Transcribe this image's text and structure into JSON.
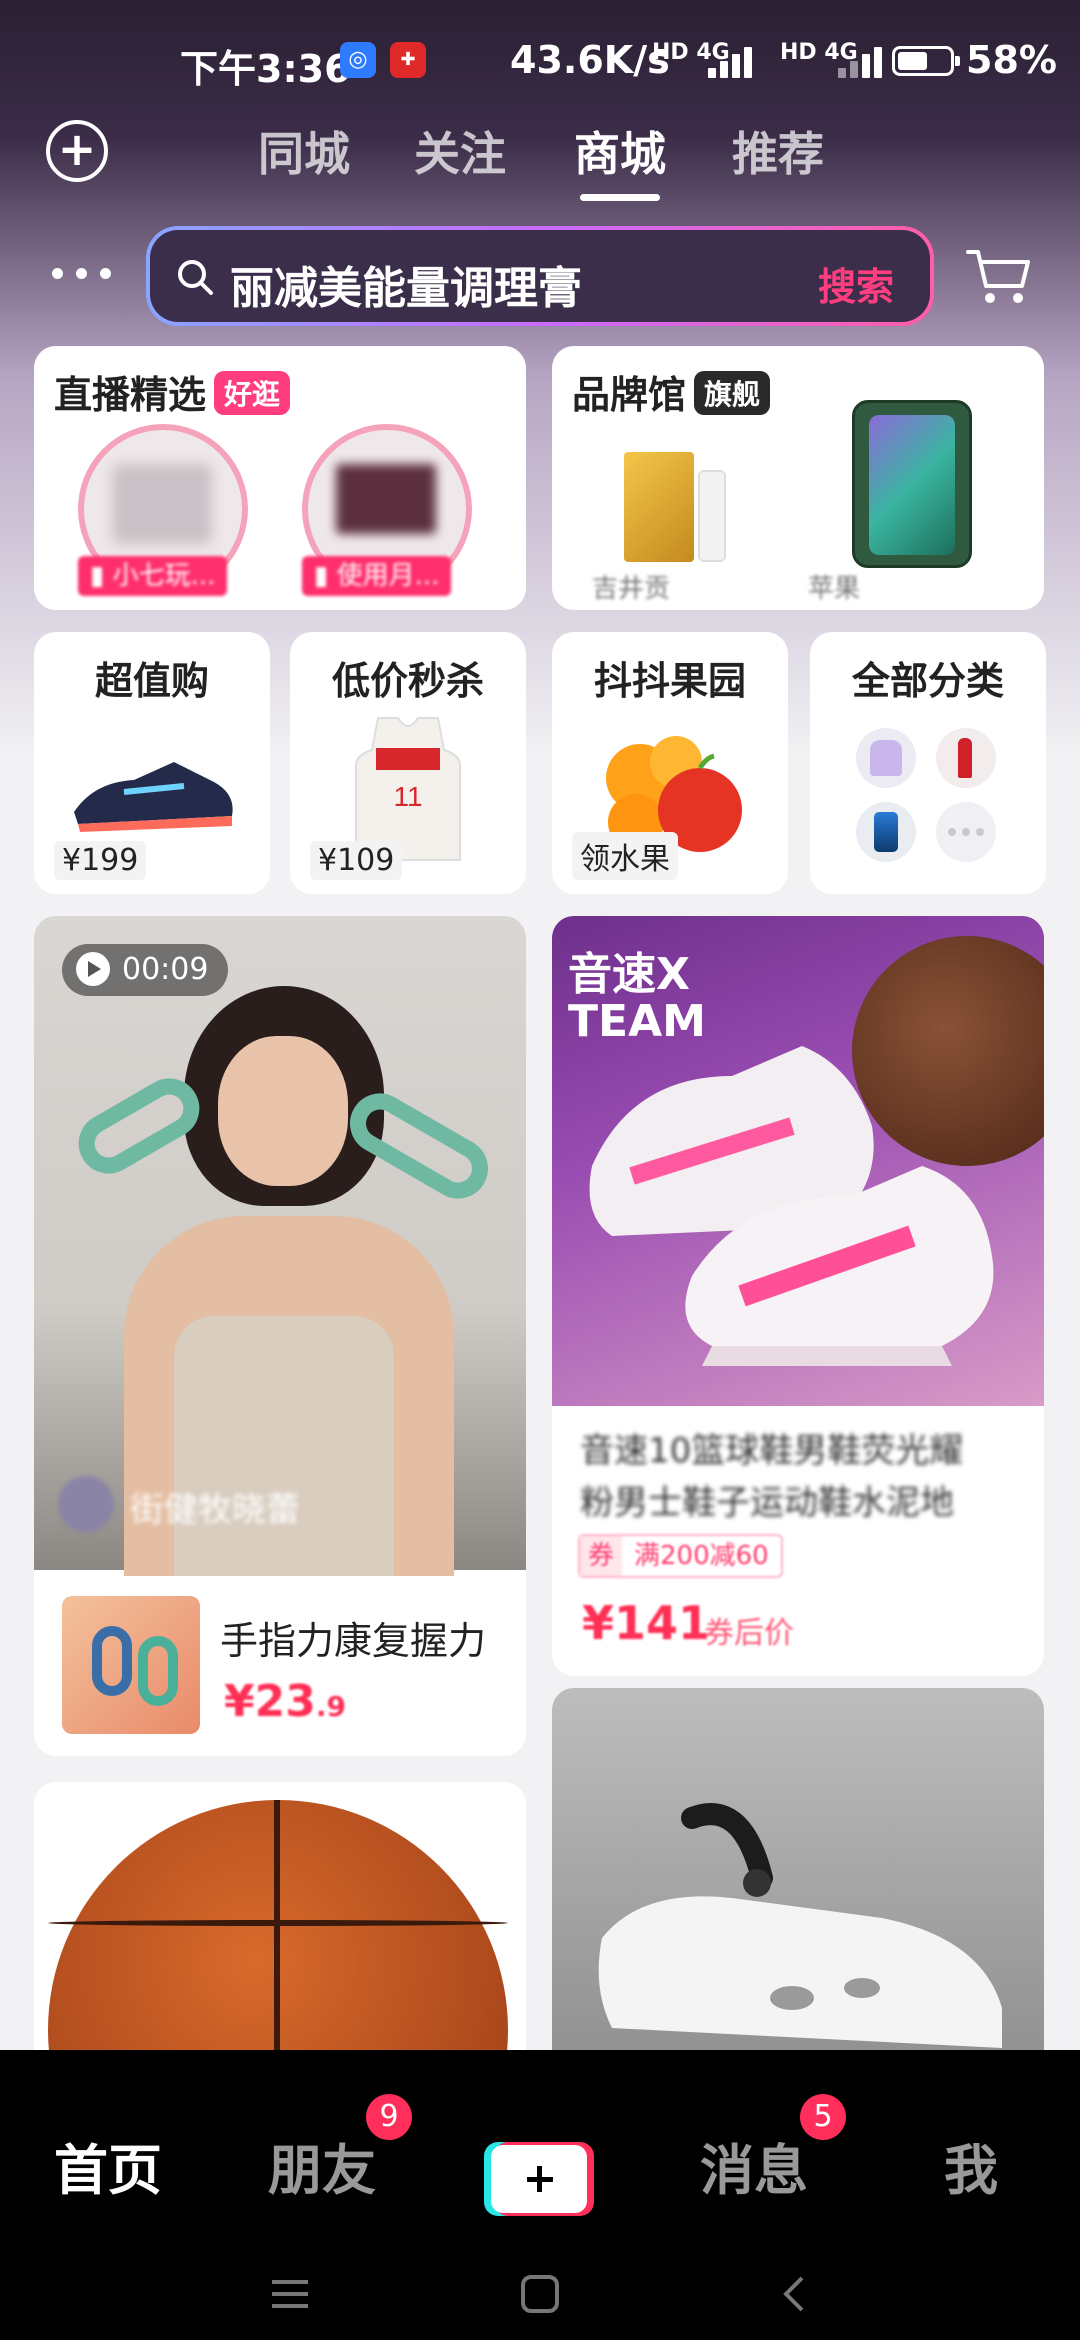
{
  "status_bar": {
    "time": "下午3:36",
    "app_icon_1": "app-notification-icon",
    "app_icon_2": "app-notification-icon",
    "net_speed": "43.6K/s",
    "net1": "HD 4G",
    "net2": "HD 4G",
    "battery_percent": "58%",
    "battery_level": 0.58
  },
  "top_nav": {
    "tabs": [
      {
        "label": "同城",
        "active": false
      },
      {
        "label": "关注",
        "active": false
      },
      {
        "label": "商城",
        "active": true
      },
      {
        "label": "推荐",
        "active": false
      }
    ]
  },
  "search": {
    "query": "丽减美能量调理膏",
    "button_label": "搜索"
  },
  "live_card": {
    "title": "直播精选",
    "tag": "好逛",
    "streamers": [
      "小七玩...",
      "使用月..."
    ]
  },
  "brand_card": {
    "title": "品牌馆",
    "tag": "旗舰",
    "brands": [
      "吉井贡",
      "苹果"
    ]
  },
  "mini_cards": [
    {
      "title": "超值购",
      "price": "¥199"
    },
    {
      "title": "低价秒杀",
      "price": "¥109"
    },
    {
      "title": "抖抖果园",
      "price": "领水果"
    },
    {
      "title": "全部分类",
      "price": ""
    }
  ],
  "feed": {
    "video_card": {
      "duration": "00:09",
      "author": "街健牧晓蕾",
      "product_title": "手指力康复握力",
      "price_main": "¥23",
      "price_decimal": ".9"
    },
    "shoe_card": {
      "image_text_1": "音速X",
      "image_text_2": "TEAM",
      "title_line1": "音速10篮球鞋男鞋荧光耀",
      "title_line2": "粉男士鞋子运动鞋水泥地",
      "coupon_label": "券",
      "coupon_value": "满200减60",
      "price": "¥141",
      "price_suffix": "券后价"
    }
  },
  "bottom_nav": {
    "items": [
      {
        "label": "首页",
        "active": true
      },
      {
        "label": "朋友",
        "badge": "9"
      },
      {
        "label": "消息",
        "badge": "5"
      },
      {
        "label": "我"
      }
    ]
  },
  "colors": {
    "accent_pink": "#ff3d7f",
    "price_red": "#ff2f55",
    "nav_bg": "#000000"
  }
}
